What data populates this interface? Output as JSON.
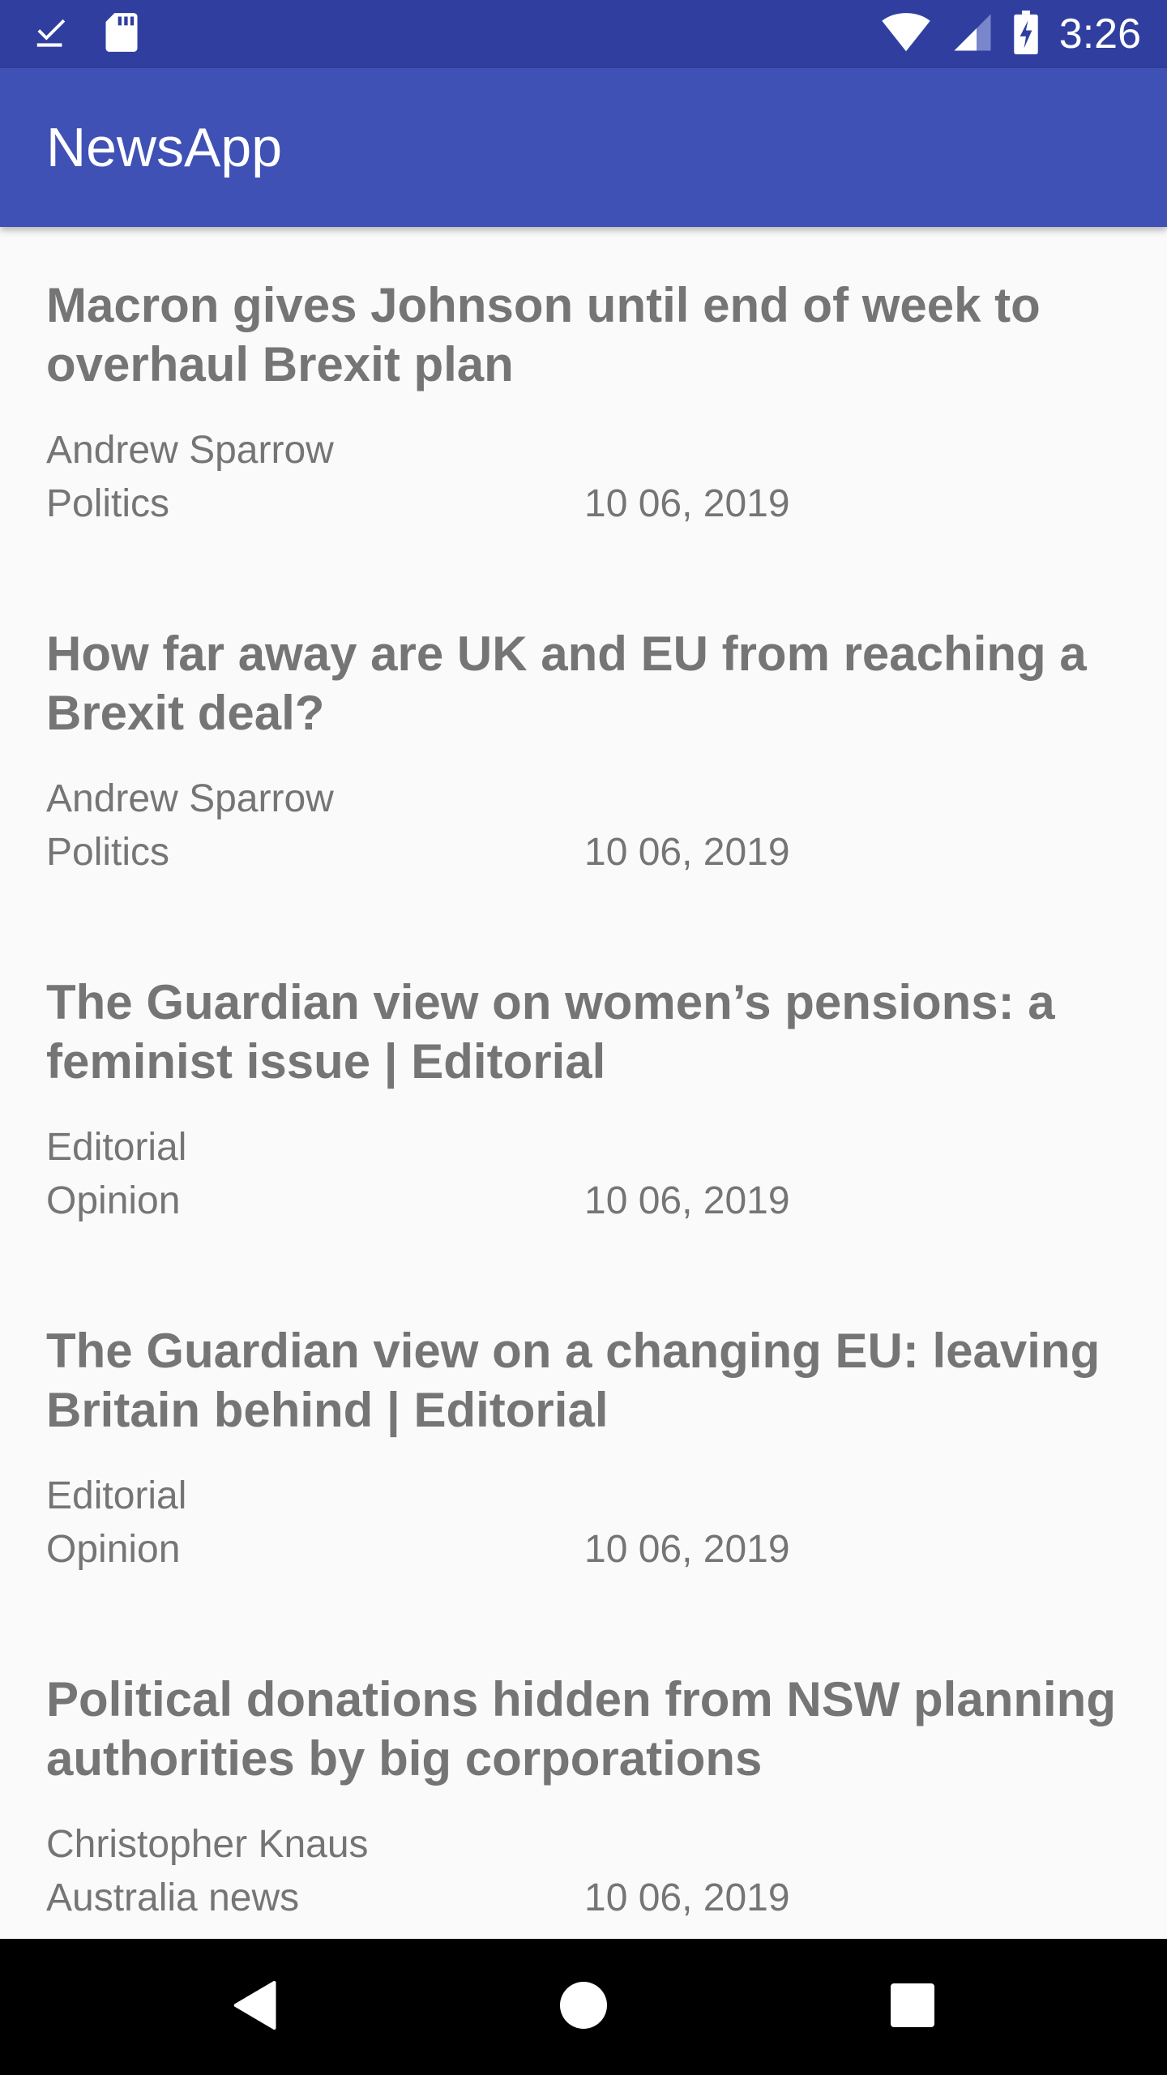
{
  "status_bar": {
    "time": "3:26",
    "left_icons": [
      "download-done-icon",
      "sd-card-icon"
    ],
    "right_icons": [
      "wifi-icon",
      "cell-signal-icon",
      "battery-charging-icon"
    ]
  },
  "app_bar": {
    "title": "NewsApp",
    "color": "#3f51b5",
    "status_color": "#303f9f"
  },
  "articles": [
    {
      "title": "Macron gives Johnson until end of week to overhaul Brexit plan",
      "author": "Andrew Sparrow",
      "section": "Politics",
      "date": "10 06, 2019"
    },
    {
      "title": "How far away are UK and EU from reaching a Brexit deal?",
      "author": "Andrew Sparrow",
      "section": "Politics",
      "date": "10 06, 2019"
    },
    {
      "title": "The Guardian view on women’s pensions: a feminist issue | Editorial",
      "author": "Editorial",
      "section": "Opinion",
      "date": "10 06, 2019"
    },
    {
      "title": "The Guardian view on a changing EU: leaving Britain behind | Editorial",
      "author": "Editorial",
      "section": "Opinion",
      "date": "10 06, 2019"
    },
    {
      "title": "Political donations hidden from NSW planning authorities by big corporations",
      "author": "Christopher Knaus",
      "section": "Australia news",
      "date": "10 06, 2019"
    }
  ],
  "nav_bar": {
    "buttons": [
      "back-icon",
      "home-icon",
      "recents-icon"
    ]
  }
}
